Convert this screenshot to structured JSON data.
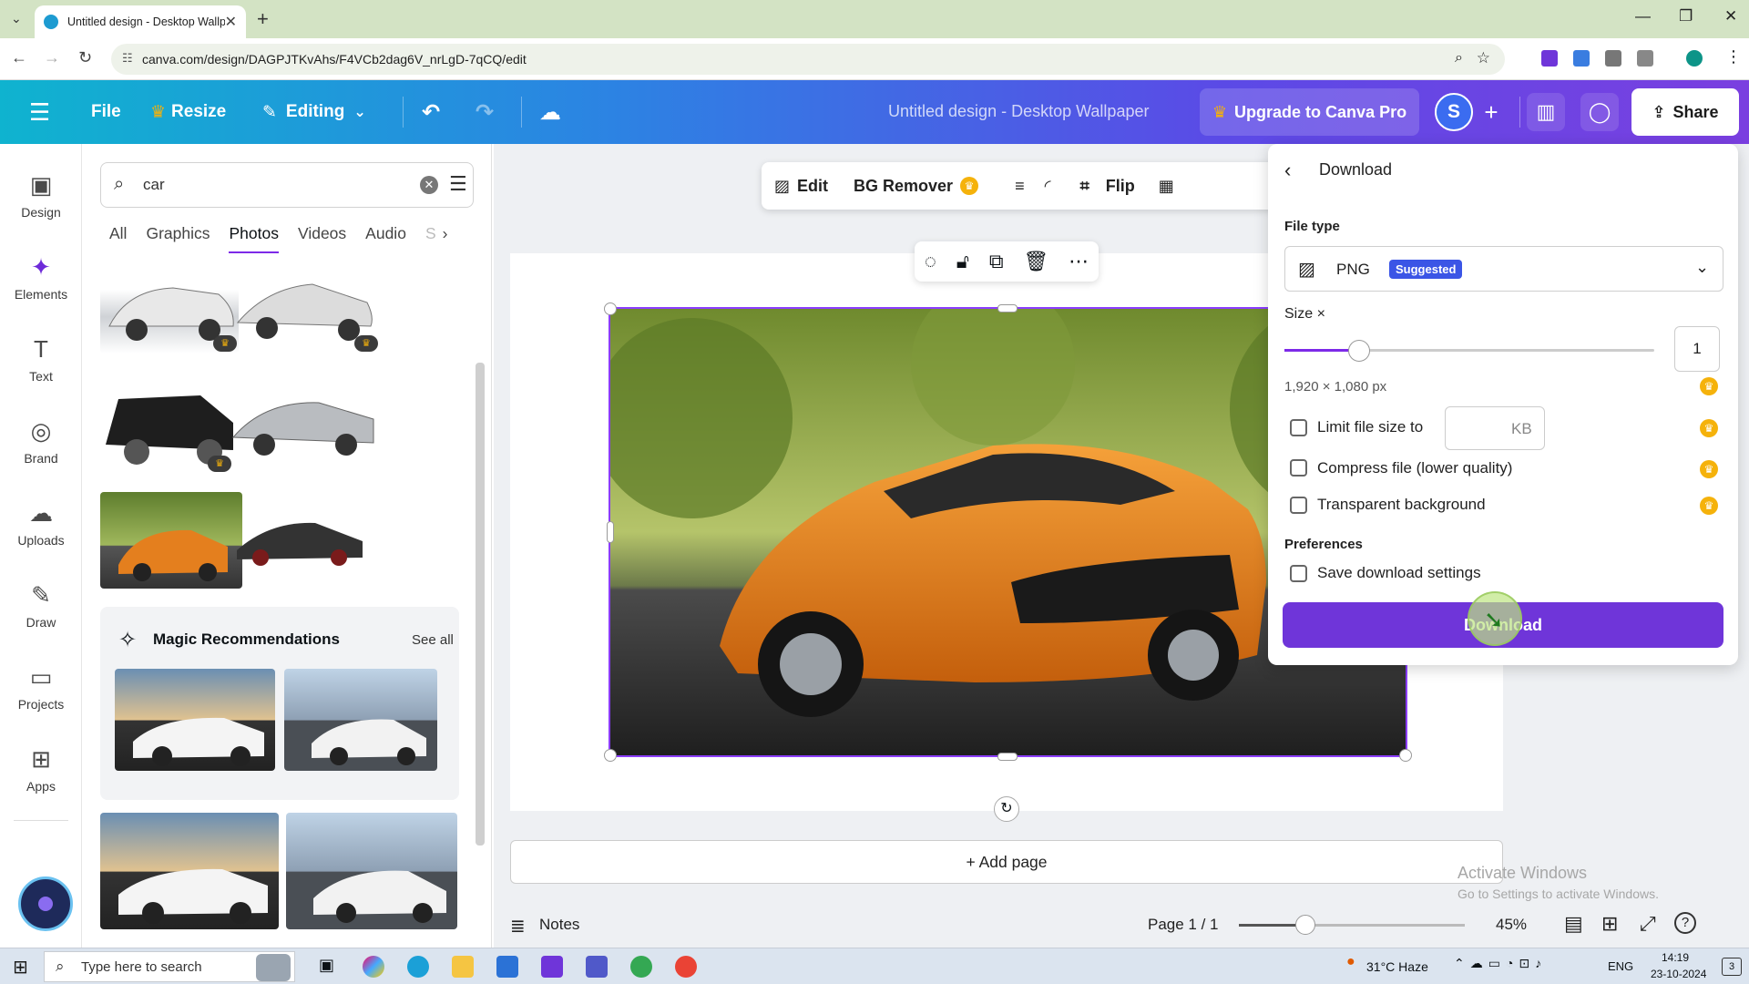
{
  "browser": {
    "tab_title": "Untitled design - Desktop Wallp",
    "url": "canva.com/design/DAGPJTKvAhs/F4VCb2dag6V_nrLgD-7qCQ/edit"
  },
  "header": {
    "file": "File",
    "resize": "Resize",
    "editing": "Editing",
    "title": "Untitled design - Desktop Wallpaper",
    "upgrade": "Upgrade to Canva Pro",
    "avatar": "S",
    "share": "Share"
  },
  "rail": {
    "items": [
      {
        "label": "Design"
      },
      {
        "label": "Elements"
      },
      {
        "label": "Text"
      },
      {
        "label": "Brand"
      },
      {
        "label": "Uploads"
      },
      {
        "label": "Draw"
      },
      {
        "label": "Projects"
      },
      {
        "label": "Apps"
      }
    ]
  },
  "panel": {
    "search_value": "car",
    "categories": [
      "All",
      "Graphics",
      "Photos",
      "Videos",
      "Audio",
      "S"
    ],
    "active_category": "Photos",
    "magic_title": "Magic Recommendations",
    "see_all": "See all"
  },
  "toolbar": {
    "edit": "Edit",
    "bg_remover": "BG Remover",
    "flip": "Flip"
  },
  "canvas": {
    "add_page": "+ Add page"
  },
  "footer": {
    "notes": "Notes",
    "page": "Page 1 / 1",
    "zoom": "45%",
    "zoom_level": 0.45
  },
  "download_panel": {
    "title": "Download",
    "file_type_label": "File type",
    "file_type": "PNG",
    "suggested": "Suggested",
    "size_label": "Size ×",
    "size_value": "1",
    "dimensions": "1,920 × 1,080 px",
    "limit_label": "Limit file size to",
    "kb": "KB",
    "compress_label": "Compress file (lower quality)",
    "transparent_label": "Transparent background",
    "preferences_label": "Preferences",
    "save_settings_label": "Save download settings",
    "download_button": "Download"
  },
  "watermark": {
    "line1": "Activate Windows",
    "line2": "Go to Settings to activate Windows."
  },
  "taskbar": {
    "search_placeholder": "Type here to search",
    "weather": "31°C  Haze",
    "lang": "ENG",
    "time": "14:19",
    "date": "23-10-2024",
    "notif_count": "3"
  },
  "colors": {
    "accent": "#8b3dff",
    "download_button": "#6f35d9",
    "premium": "#f5b20b"
  }
}
